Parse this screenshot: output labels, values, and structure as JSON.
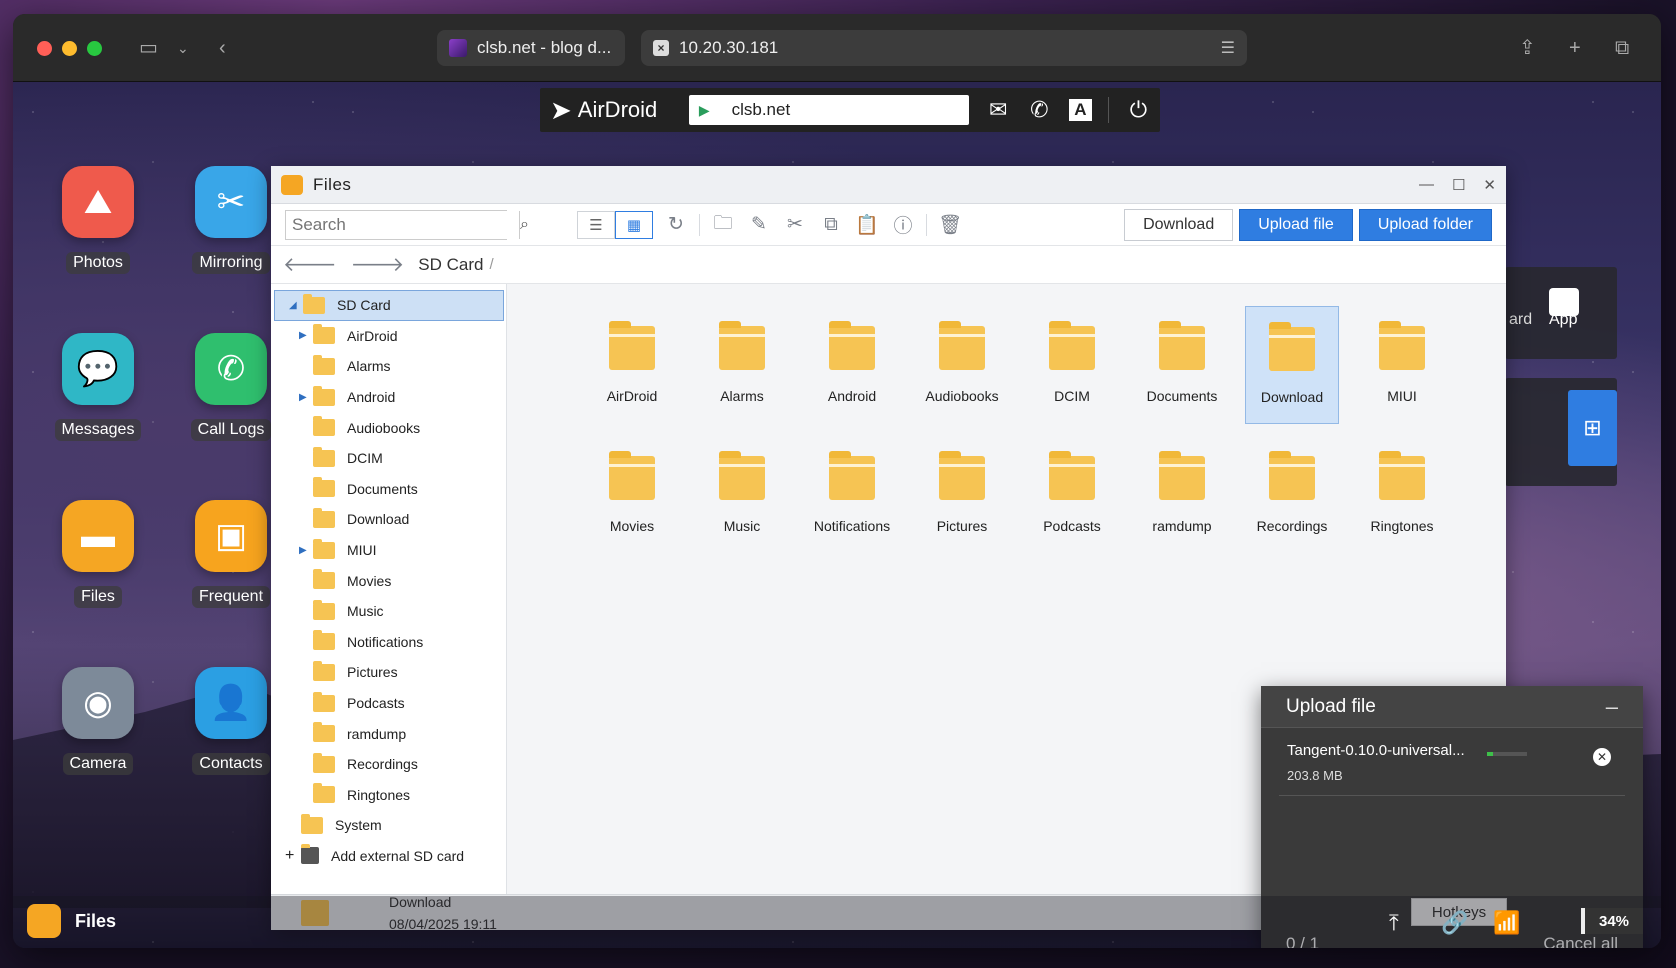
{
  "browser": {
    "tabs": [
      {
        "label": "clsb.net - blog d..."
      },
      {
        "label": "10.20.30.181"
      }
    ]
  },
  "airdroid": {
    "logo": "AirDroid",
    "url": "clsb.net"
  },
  "desktop": {
    "icons": [
      {
        "label": "Photos",
        "color": "#ef5a4c"
      },
      {
        "label": "Mirroring",
        "color": "#39a6e8"
      },
      {
        "label": "Messages",
        "color": "#2fb7c6"
      },
      {
        "label": "Call Logs",
        "color": "#2fbf6e"
      },
      {
        "label": "Files",
        "color": "#f5a623"
      },
      {
        "label": "Frequent",
        "color": "#f7a41e"
      },
      {
        "label": "Camera",
        "color": "#7d8a99"
      },
      {
        "label": "Contacts",
        "color": "#2b9fe3"
      }
    ]
  },
  "files_window": {
    "title": "Files",
    "search_placeholder": "Search",
    "buttons": {
      "download": "Download",
      "upload_file": "Upload file",
      "upload_folder": "Upload folder"
    },
    "breadcrumb": "SD Card",
    "breadcrumb_sep": "/",
    "tree": {
      "root": "SD Card",
      "items": [
        {
          "label": "AirDroid",
          "expandable": true
        },
        {
          "label": "Alarms",
          "expandable": false
        },
        {
          "label": "Android",
          "expandable": true
        },
        {
          "label": "Audiobooks",
          "expandable": false
        },
        {
          "label": "DCIM",
          "expandable": false
        },
        {
          "label": "Documents",
          "expandable": false
        },
        {
          "label": "Download",
          "expandable": false
        },
        {
          "label": "MIUI",
          "expandable": true
        },
        {
          "label": "Movies",
          "expandable": false
        },
        {
          "label": "Music",
          "expandable": false
        },
        {
          "label": "Notifications",
          "expandable": false
        },
        {
          "label": "Pictures",
          "expandable": false
        },
        {
          "label": "Podcasts",
          "expandable": false
        },
        {
          "label": "ramdump",
          "expandable": false
        },
        {
          "label": "Recordings",
          "expandable": false
        },
        {
          "label": "Ringtones",
          "expandable": false
        }
      ],
      "system": "System",
      "add_external": "Add external SD card"
    },
    "grid": [
      "AirDroid",
      "Alarms",
      "Android",
      "Audiobooks",
      "DCIM",
      "Documents",
      "Download",
      "MIUI",
      "Movies",
      "Music",
      "Notifications",
      "Pictures",
      "Podcasts",
      "ramdump",
      "Recordings",
      "Ringtones"
    ],
    "selected": "Download",
    "status": {
      "name": "Download",
      "date": "08/04/2025 19:11"
    }
  },
  "side_dock": {
    "partial_label": "ard",
    "app_label": "App"
  },
  "upload_panel": {
    "title": "Upload file",
    "file_name": "Tangent-0.10.0-universal...",
    "file_size": "203.8 MB",
    "progress": 0.15,
    "counter": "0 / 1",
    "cancel_all": "Cancel all"
  },
  "hotkeys": "Hotkeys",
  "bottom_bar": {
    "app_name": "Files",
    "battery": "34%"
  }
}
